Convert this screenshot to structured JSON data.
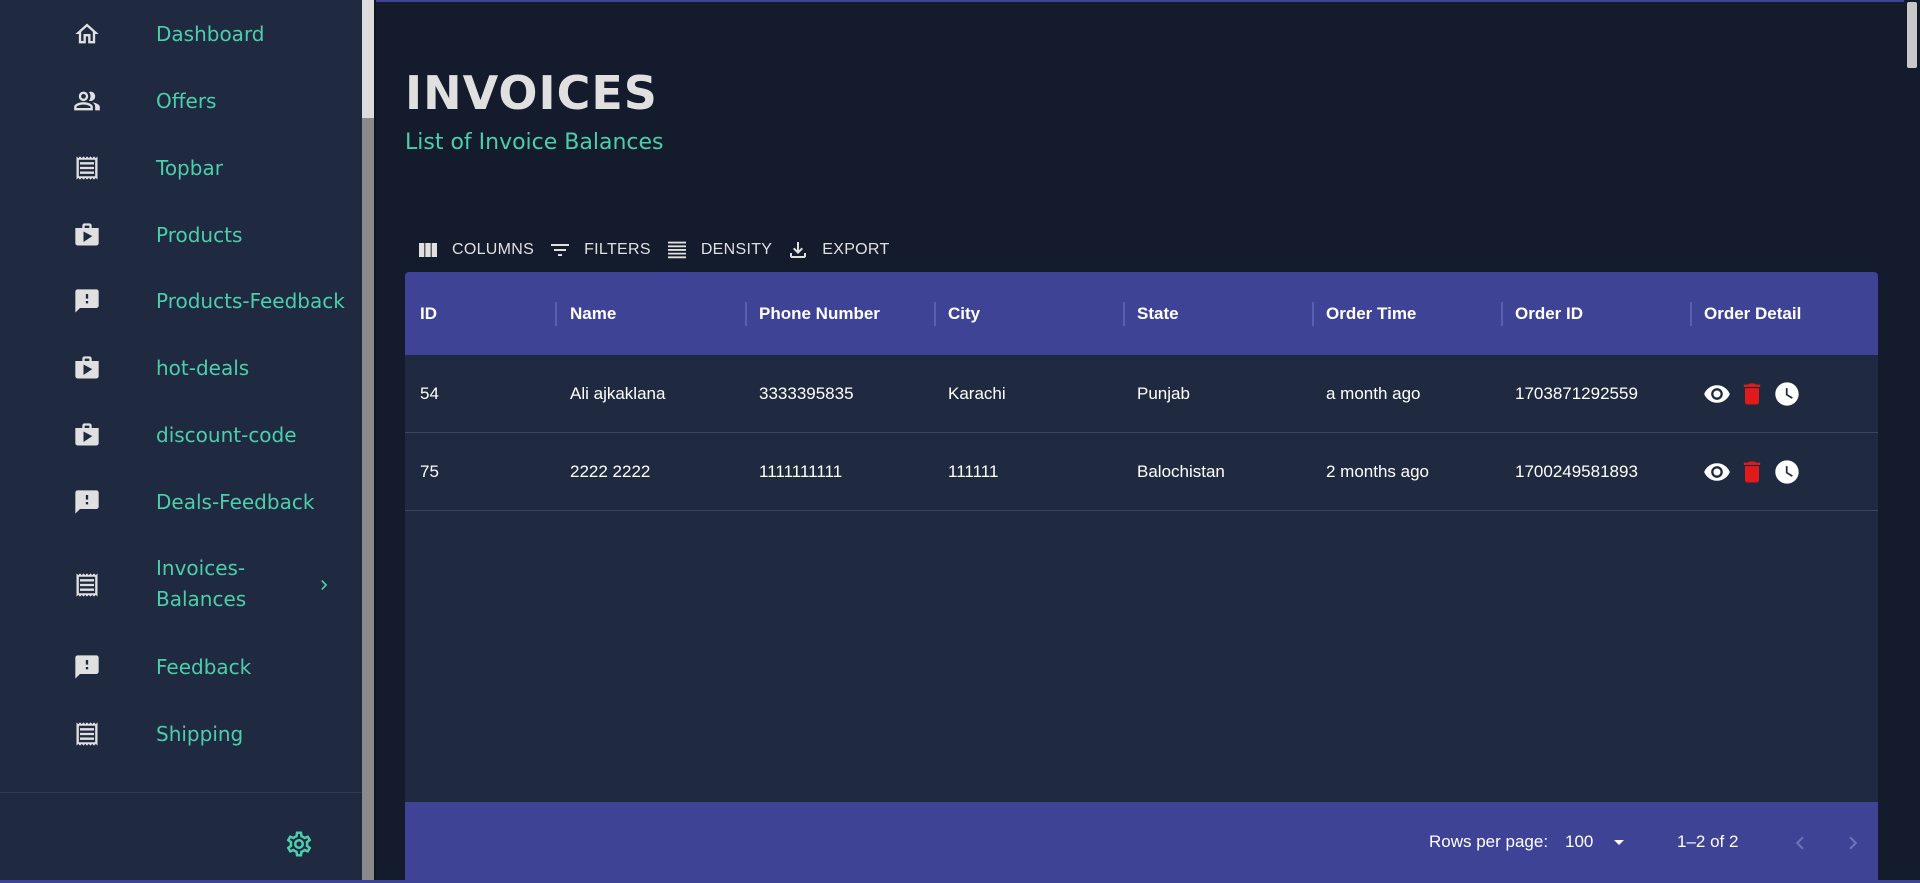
{
  "sidebar": {
    "items": [
      {
        "label": "Dashboard",
        "icon": "home-icon"
      },
      {
        "label": "Offers",
        "icon": "people-icon"
      },
      {
        "label": "Topbar",
        "icon": "receipt-icon"
      },
      {
        "label": "Products",
        "icon": "shop-icon"
      },
      {
        "label": "Products-Feedback",
        "icon": "feedback-icon"
      },
      {
        "label": "hot-deals",
        "icon": "shop-icon"
      },
      {
        "label": "discount-code",
        "icon": "shop-icon"
      },
      {
        "label": "Deals-Feedback",
        "icon": "feedback-icon"
      },
      {
        "label": "Invoices-",
        "label2": "Balances",
        "icon": "receipt-icon"
      },
      {
        "label": "Feedback",
        "icon": "feedback-icon"
      },
      {
        "label": "Shipping",
        "icon": "receipt-icon"
      }
    ]
  },
  "header": {
    "title": "INVOICES",
    "subtitle": "List of Invoice Balances"
  },
  "toolbar": {
    "columns": "COLUMNS",
    "filters": "FILTERS",
    "density": "DENSITY",
    "export": "EXPORT"
  },
  "grid": {
    "columns": [
      "ID",
      "Name",
      "Phone Number",
      "City",
      "State",
      "Order Time",
      "Order ID",
      "Order Detail"
    ],
    "rows": [
      {
        "id": "54",
        "name": "Ali ajkaklana",
        "phone": "3333395835",
        "city": "Karachi",
        "state": "Punjab",
        "time": "a month ago",
        "order_id": "1703871292559"
      },
      {
        "id": "75",
        "name": "2222 2222",
        "phone": "1111111111",
        "city": "111111",
        "state": "Balochistan",
        "time": "2 months ago",
        "order_id": "1700249581893"
      }
    ]
  },
  "footer": {
    "rows_per_page_label": "Rows per page:",
    "rows_per_page_value": "100",
    "range": "1–2 of 2"
  },
  "colors": {
    "accent": "#4cceac",
    "header_bg": "#3e4396",
    "panel_bg": "#1f2a40",
    "page_bg": "#141b2d",
    "delete": "#e01b1b"
  }
}
